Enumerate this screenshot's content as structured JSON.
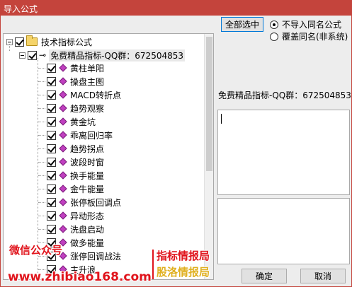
{
  "window": {
    "title": "导入公式"
  },
  "tree": {
    "root": {
      "label": "技术指标公式",
      "checked": true
    },
    "group": {
      "label": "免费精品指标-QQ群：672504853",
      "checked": true
    },
    "items": [
      {
        "label": "黄柱单阳",
        "checked": true
      },
      {
        "label": "操盘主图",
        "checked": true
      },
      {
        "label": "MACD转折点",
        "checked": true
      },
      {
        "label": "趋势观察",
        "checked": true
      },
      {
        "label": "黄金坑",
        "checked": true
      },
      {
        "label": "乖离回归率",
        "checked": true
      },
      {
        "label": "趋势拐点",
        "checked": true
      },
      {
        "label": "波段时窗",
        "checked": true
      },
      {
        "label": "换手能量",
        "checked": true
      },
      {
        "label": "金牛能量",
        "checked": true
      },
      {
        "label": "张停板回调点",
        "checked": true
      },
      {
        "label": "异动形态",
        "checked": true
      },
      {
        "label": "洗盘启动",
        "checked": true
      },
      {
        "label": "做多能量",
        "checked": true
      },
      {
        "label": "涨停回调战法",
        "checked": true
      },
      {
        "label": "主升浪",
        "checked": true
      }
    ]
  },
  "controls": {
    "select_all_label": "全部选中",
    "option_no_import": "不导入同名公式",
    "option_overwrite": "覆盖同名(非系统)",
    "selected_option": "no_import",
    "selected_name": "免费精品指标-QQ群：672504853",
    "ok_label": "确定",
    "cancel_label": "取消"
  },
  "watermark": {
    "wechat": "微信公众号",
    "brand_line1": "指标情报局",
    "brand_line2": "股洛情报局",
    "url": "www.zhibiao168.com"
  },
  "colors": {
    "titlebar": "#c4443c",
    "watermark_red": "#e0141c",
    "watermark_gold": "#e0b020",
    "gem": "#c040c0"
  }
}
